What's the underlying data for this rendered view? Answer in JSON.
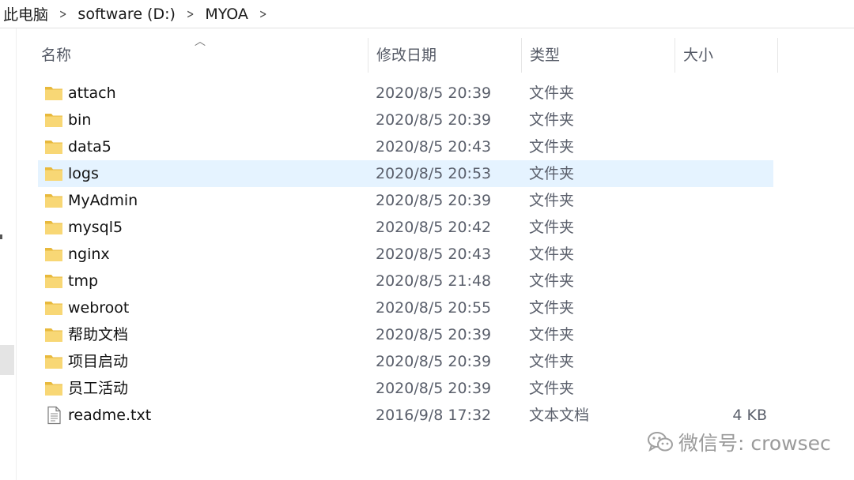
{
  "breadcrumb": {
    "items": [
      "此电脑",
      "software (D:)",
      "MYOA"
    ],
    "separator": ">"
  },
  "columns": {
    "name": "名称",
    "date": "修改日期",
    "type": "类型",
    "size": "大小"
  },
  "colors": {
    "folder": "#f8d775",
    "folder_dark": "#e8b93c",
    "hover": "#e5f3ff"
  },
  "files": [
    {
      "name": "attach",
      "date": "2020/8/5 20:39",
      "type": "文件夹",
      "size": "",
      "icon": "folder-icon"
    },
    {
      "name": "bin",
      "date": "2020/8/5 20:39",
      "type": "文件夹",
      "size": "",
      "icon": "folder-icon"
    },
    {
      "name": "data5",
      "date": "2020/8/5 20:43",
      "type": "文件夹",
      "size": "",
      "icon": "folder-icon"
    },
    {
      "name": "logs",
      "date": "2020/8/5 20:53",
      "type": "文件夹",
      "size": "",
      "icon": "folder-icon",
      "hover": true
    },
    {
      "name": "MyAdmin",
      "date": "2020/8/5 20:39",
      "type": "文件夹",
      "size": "",
      "icon": "folder-icon"
    },
    {
      "name": "mysql5",
      "date": "2020/8/5 20:42",
      "type": "文件夹",
      "size": "",
      "icon": "folder-icon"
    },
    {
      "name": "nginx",
      "date": "2020/8/5 20:43",
      "type": "文件夹",
      "size": "",
      "icon": "folder-icon"
    },
    {
      "name": "tmp",
      "date": "2020/8/5 21:48",
      "type": "文件夹",
      "size": "",
      "icon": "folder-icon"
    },
    {
      "name": "webroot",
      "date": "2020/8/5 20:55",
      "type": "文件夹",
      "size": "",
      "icon": "folder-icon"
    },
    {
      "name": "帮助文档",
      "date": "2020/8/5 20:39",
      "type": "文件夹",
      "size": "",
      "icon": "folder-icon"
    },
    {
      "name": "项目启动",
      "date": "2020/8/5 20:39",
      "type": "文件夹",
      "size": "",
      "icon": "folder-icon"
    },
    {
      "name": "员工活动",
      "date": "2020/8/5 20:39",
      "type": "文件夹",
      "size": "",
      "icon": "folder-icon"
    },
    {
      "name": "readme.txt",
      "date": "2016/9/8 17:32",
      "type": "文本文档",
      "size": "4 KB",
      "icon": "text-file-icon"
    }
  ],
  "watermark": {
    "text": "微信号: crowsec",
    "icon": "wechat-icon"
  }
}
